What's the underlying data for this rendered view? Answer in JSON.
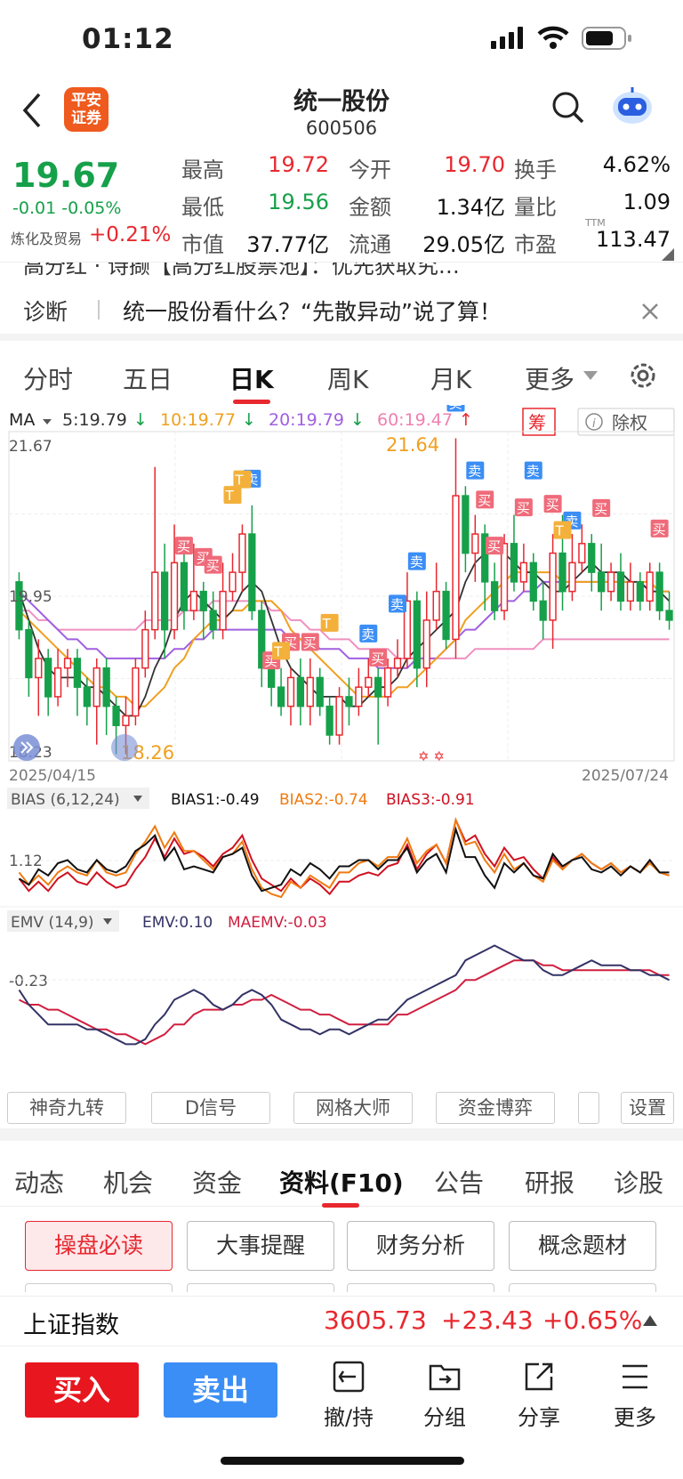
{
  "status": {
    "time": "01:12"
  },
  "nav": {
    "logo_line1": "平安",
    "logo_line2": "证券",
    "title": "统一股份",
    "code": "600506"
  },
  "quote": {
    "price": "19.67",
    "change": "-0.01",
    "change_pct": "-0.05%",
    "sector_name": "炼化及贸易",
    "sector_pct": "+0.21%",
    "rows": [
      [
        {
          "label": "最高",
          "value": "19.72",
          "c": "up"
        },
        {
          "label": "今开",
          "value": "19.70",
          "c": "up"
        },
        {
          "label": "换手",
          "value": "4.62%",
          "c": "blk"
        }
      ],
      [
        {
          "label": "最低",
          "value": "19.56",
          "c": "dn"
        },
        {
          "label": "金额",
          "value": "1.34亿",
          "c": "blk"
        },
        {
          "label": "量比",
          "value": "1.09",
          "c": "blk"
        }
      ],
      [
        {
          "label": "市值",
          "value": "37.77亿",
          "c": "blk"
        },
        {
          "label": "流通",
          "value": "29.05亿",
          "c": "blk"
        },
        {
          "label": "市盈",
          "value": "113.47",
          "c": "blk"
        }
      ]
    ],
    "ttm": "TTM"
  },
  "news": {
    "partial_line": "高分红 · 诗撷【高分红股票池】：优先获取究…",
    "tag": "诊断",
    "headline": "统一股份看什么？“先散异动”说了算！"
  },
  "period_tabs": [
    "分时",
    "五日",
    "日K",
    "周K",
    "月K",
    "更多"
  ],
  "period_active": 2,
  "ma": {
    "label": "MA",
    "items": [
      {
        "text": "5:19.79",
        "color": "#333",
        "dir": "↓"
      },
      {
        "text": "10:19.77",
        "color": "#f0a020",
        "dir": "↓"
      },
      {
        "text": "20:19.79",
        "color": "#a060e0",
        "dir": "↓"
      },
      {
        "text": "60:19.47",
        "color": "#ef80b0",
        "dir": "↑"
      }
    ],
    "chip": "筹",
    "exright": "除权"
  },
  "chart_data": {
    "type": "candlestick",
    "date_start": "2025/04/15",
    "date_end": "2025/07/24",
    "y_labels": [
      "21.67",
      "19.95",
      "18.23"
    ],
    "high_label": "21.64",
    "low_label": "18.26",
    "ylim": [
      18.23,
      21.67
    ],
    "buy_label": "买",
    "sell_label": "卖",
    "t_label": "T",
    "candles": [
      [
        20.1,
        19.6,
        20.2,
        19.5
      ],
      [
        19.6,
        19.1,
        19.7,
        18.9
      ],
      [
        19.1,
        19.3,
        19.5,
        18.7
      ],
      [
        19.3,
        18.9,
        19.4,
        18.7
      ],
      [
        18.9,
        19.2,
        19.4,
        18.8
      ],
      [
        19.2,
        19.3,
        19.4,
        19.0
      ],
      [
        19.3,
        19.0,
        19.4,
        18.7
      ],
      [
        19.0,
        18.8,
        19.1,
        18.6
      ],
      [
        18.8,
        19.2,
        19.3,
        18.4
      ],
      [
        19.2,
        18.8,
        19.3,
        18.5
      ],
      [
        18.8,
        18.6,
        18.9,
        18.3
      ],
      [
        18.6,
        18.7,
        18.9,
        18.3
      ],
      [
        18.7,
        19.2,
        19.3,
        18.6
      ],
      [
        19.2,
        19.6,
        19.8,
        19.1
      ],
      [
        19.6,
        20.2,
        21.3,
        19.5
      ],
      [
        20.2,
        19.6,
        20.5,
        19.3
      ],
      [
        19.6,
        20.3,
        20.7,
        19.5
      ],
      [
        20.3,
        19.8,
        20.4,
        19.6
      ],
      [
        19.8,
        20.0,
        20.5,
        19.7
      ],
      [
        20.0,
        19.8,
        20.1,
        19.5
      ],
      [
        19.8,
        19.6,
        20.0,
        19.5
      ],
      [
        19.6,
        20.0,
        20.3,
        19.5
      ],
      [
        20.0,
        20.2,
        20.4,
        19.9
      ],
      [
        20.2,
        20.6,
        20.7,
        20.0
      ],
      [
        20.6,
        19.8,
        20.9,
        19.7
      ],
      [
        19.8,
        19.2,
        19.9,
        19.0
      ],
      [
        19.2,
        19.0,
        19.3,
        18.8
      ],
      [
        19.0,
        18.8,
        19.2,
        18.7
      ],
      [
        18.8,
        19.1,
        19.2,
        18.6
      ],
      [
        19.1,
        18.8,
        19.3,
        18.6
      ],
      [
        18.8,
        19.1,
        19.3,
        18.6
      ],
      [
        19.1,
        18.8,
        19.2,
        18.7
      ],
      [
        18.8,
        18.5,
        18.9,
        18.4
      ],
      [
        18.5,
        18.9,
        19.0,
        18.4
      ],
      [
        18.9,
        18.8,
        19.1,
        18.6
      ],
      [
        18.8,
        19.0,
        19.2,
        18.7
      ],
      [
        19.0,
        19.1,
        19.3,
        18.9
      ],
      [
        19.1,
        18.9,
        19.2,
        18.4
      ],
      [
        18.9,
        19.2,
        19.3,
        18.8
      ],
      [
        19.2,
        19.3,
        19.5,
        19.1
      ],
      [
        19.3,
        19.9,
        20.2,
        19.2
      ],
      [
        19.9,
        19.2,
        20.0,
        19.0
      ],
      [
        19.2,
        19.7,
        20.0,
        19.0
      ],
      [
        19.7,
        20.0,
        20.3,
        19.6
      ],
      [
        20.0,
        19.5,
        20.1,
        19.4
      ],
      [
        19.5,
        21.0,
        21.6,
        19.3
      ],
      [
        21.0,
        20.4,
        21.1,
        20.2
      ],
      [
        20.4,
        20.6,
        20.8,
        20.1
      ],
      [
        20.6,
        20.1,
        20.7,
        19.8
      ],
      [
        20.1,
        19.8,
        20.3,
        19.7
      ],
      [
        19.8,
        20.5,
        20.6,
        19.7
      ],
      [
        20.5,
        20.1,
        20.8,
        20.0
      ],
      [
        20.1,
        20.3,
        20.5,
        20.0
      ],
      [
        20.3,
        19.9,
        20.4,
        19.8
      ],
      [
        19.9,
        19.7,
        20.1,
        19.5
      ],
      [
        19.7,
        20.4,
        20.6,
        19.4
      ],
      [
        20.4,
        20.0,
        20.8,
        19.8
      ],
      [
        20.0,
        20.3,
        20.6,
        19.9
      ],
      [
        20.3,
        20.5,
        20.7,
        20.2
      ],
      [
        20.5,
        20.2,
        20.6,
        20.0
      ],
      [
        20.2,
        20.0,
        20.5,
        19.8
      ],
      [
        20.0,
        20.2,
        20.3,
        19.9
      ],
      [
        20.2,
        19.9,
        20.4,
        19.8
      ],
      [
        19.9,
        20.1,
        20.3,
        19.8
      ],
      [
        20.1,
        19.9,
        20.2,
        19.8
      ],
      [
        19.9,
        20.2,
        20.3,
        19.8
      ],
      [
        20.2,
        19.8,
        20.3,
        19.7
      ],
      [
        19.8,
        19.7,
        20.0,
        19.6
      ]
    ],
    "ma5": [
      20.0,
      19.7,
      19.4,
      19.2,
      19.1,
      19.1,
      19.1,
      19.0,
      19.0,
      18.9,
      18.8,
      18.7,
      18.7,
      18.9,
      19.2,
      19.4,
      19.7,
      19.9,
      20.0,
      19.9,
      19.8,
      19.7,
      19.8,
      20.0,
      20.1,
      20.0,
      19.7,
      19.4,
      19.2,
      19.1,
      19.0,
      18.9,
      18.9,
      18.9,
      18.8,
      18.8,
      18.9,
      19.0,
      19.0,
      19.1,
      19.3,
      19.4,
      19.5,
      19.6,
      19.7,
      19.8,
      20.1,
      20.3,
      20.4,
      20.5,
      20.4,
      20.3,
      20.2,
      20.2,
      20.1,
      20.0,
      20.0,
      20.1,
      20.2,
      20.3,
      20.2,
      20.2,
      20.2,
      20.1,
      20.1,
      20.0,
      20.0,
      19.9
    ],
    "ma10": [
      19.8,
      19.7,
      19.6,
      19.5,
      19.4,
      19.3,
      19.2,
      19.1,
      19.0,
      19.0,
      18.9,
      18.9,
      18.8,
      18.8,
      18.9,
      19.0,
      19.2,
      19.3,
      19.5,
      19.6,
      19.7,
      19.7,
      19.8,
      19.8,
      19.9,
      19.9,
      19.9,
      19.8,
      19.6,
      19.5,
      19.4,
      19.3,
      19.2,
      19.1,
      19.0,
      18.9,
      18.9,
      18.9,
      18.9,
      19.0,
      19.0,
      19.1,
      19.2,
      19.3,
      19.4,
      19.5,
      19.7,
      19.8,
      19.9,
      20.0,
      20.1,
      20.2,
      20.2,
      20.2,
      20.2,
      20.2,
      20.1,
      20.1,
      20.1,
      20.1,
      20.1,
      20.1,
      20.1,
      20.1,
      20.1,
      20.1,
      20.0,
      20.0
    ],
    "ma20": [
      20.0,
      19.9,
      19.8,
      19.7,
      19.6,
      19.5,
      19.5,
      19.4,
      19.4,
      19.3,
      19.3,
      19.3,
      19.3,
      19.3,
      19.3,
      19.3,
      19.4,
      19.4,
      19.5,
      19.5,
      19.6,
      19.6,
      19.6,
      19.6,
      19.6,
      19.6,
      19.6,
      19.6,
      19.5,
      19.5,
      19.5,
      19.4,
      19.4,
      19.4,
      19.3,
      19.3,
      19.3,
      19.2,
      19.2,
      19.2,
      19.2,
      19.3,
      19.3,
      19.3,
      19.4,
      19.5,
      19.6,
      19.6,
      19.7,
      19.8,
      19.9,
      19.9,
      20.0,
      20.0,
      20.1,
      20.1,
      20.1,
      20.1,
      20.1,
      20.1,
      20.1,
      20.1,
      20.1,
      20.1,
      20.1,
      20.0,
      20.0,
      20.0
    ],
    "ma60": [
      19.8,
      19.8,
      19.7,
      19.7,
      19.6,
      19.6,
      19.6,
      19.6,
      19.6,
      19.6,
      19.6,
      19.6,
      19.6,
      19.7,
      19.7,
      19.7,
      19.7,
      19.8,
      19.8,
      19.8,
      19.9,
      19.9,
      19.9,
      19.9,
      19.9,
      19.9,
      19.8,
      19.8,
      19.7,
      19.7,
      19.6,
      19.6,
      19.5,
      19.5,
      19.5,
      19.4,
      19.4,
      19.4,
      19.4,
      19.3,
      19.3,
      19.3,
      19.3,
      19.3,
      19.3,
      19.3,
      19.3,
      19.4,
      19.4,
      19.4,
      19.4,
      19.4,
      19.4,
      19.4,
      19.5,
      19.5,
      19.5,
      19.5,
      19.5,
      19.5,
      19.5,
      19.5,
      19.5,
      19.5,
      19.5,
      19.5,
      19.5,
      19.5
    ]
  },
  "bias": {
    "title": "BIAS (6,12,24)",
    "b1": "BIAS1:-0.49",
    "b2": "BIAS2:-0.74",
    "b3": "BIAS3:-0.91",
    "ref": "1.12"
  },
  "emv": {
    "title": "EMV (14,9)",
    "emv": "EMV:0.10",
    "maemv": "MAEMV:-0.03",
    "ref": "-0.23"
  },
  "tools": [
    "神奇九转",
    "D信号",
    "网格大师",
    "资金博弈",
    "",
    "设置"
  ],
  "info_tabs": [
    "动态",
    "机会",
    "资金",
    "资料(F10)",
    "公告",
    "研报",
    "诊股"
  ],
  "info_active": 3,
  "f10_buttons": [
    "操盘必读",
    "大事提醒",
    "财务分析",
    "概念题材"
  ],
  "index": {
    "name": "上证指数",
    "value": "3605.73",
    "change": "+23.43",
    "pct": "+0.65%"
  },
  "bottom": {
    "buy": "买入",
    "sell": "卖出",
    "items": [
      "撤/持",
      "分组",
      "分享",
      "更多"
    ]
  }
}
